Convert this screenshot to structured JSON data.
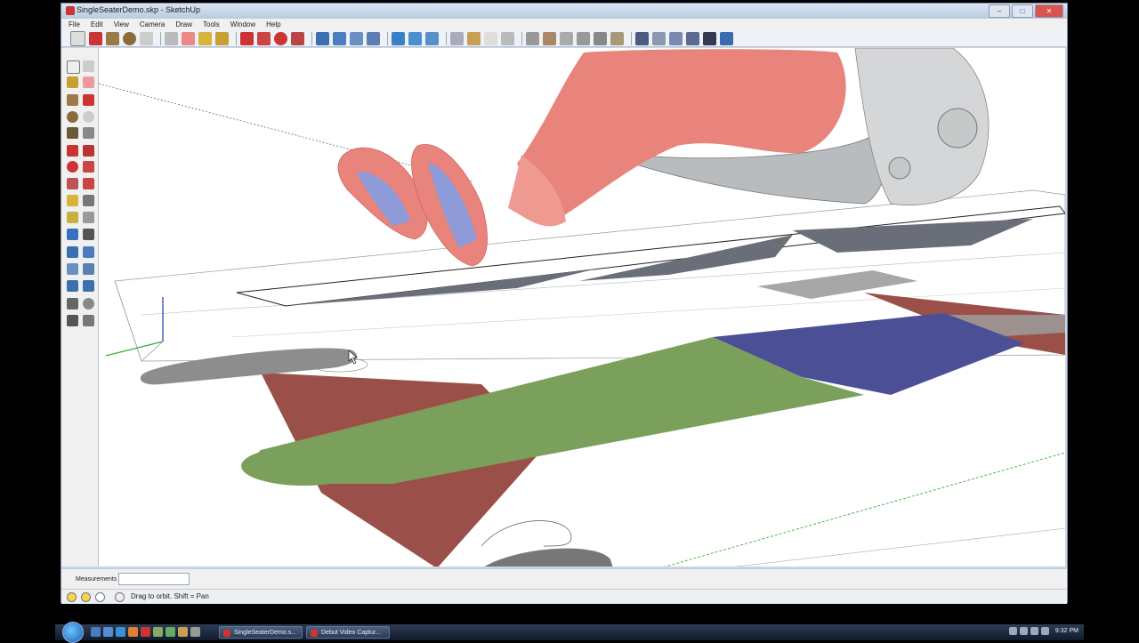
{
  "window": {
    "title": "SingleSeaterDemo.skp - SketchUp",
    "buttons": {
      "minimize": "–",
      "maximize": "□",
      "close": "✕"
    }
  },
  "menu": [
    "File",
    "Edit",
    "View",
    "Camera",
    "Draw",
    "Tools",
    "Window",
    "Help"
  ],
  "measurements": {
    "label": "Measurements",
    "value": ""
  },
  "status": {
    "hint": "Drag to orbit.  Shift = Pan"
  },
  "taskbar": {
    "tasks": [
      {
        "label": "SingleSeaterDemo.s..."
      },
      {
        "label": "Debut Video Captur..."
      }
    ],
    "clock": "9:32 PM"
  },
  "scene_colors": {
    "skin": "#e9847c",
    "seat": "#b9bcbf",
    "red_panel": "#9a5048",
    "green_panel": "#7aa05c",
    "blue_panel": "#4b4f96",
    "dark_strip": "#6a6e78"
  }
}
